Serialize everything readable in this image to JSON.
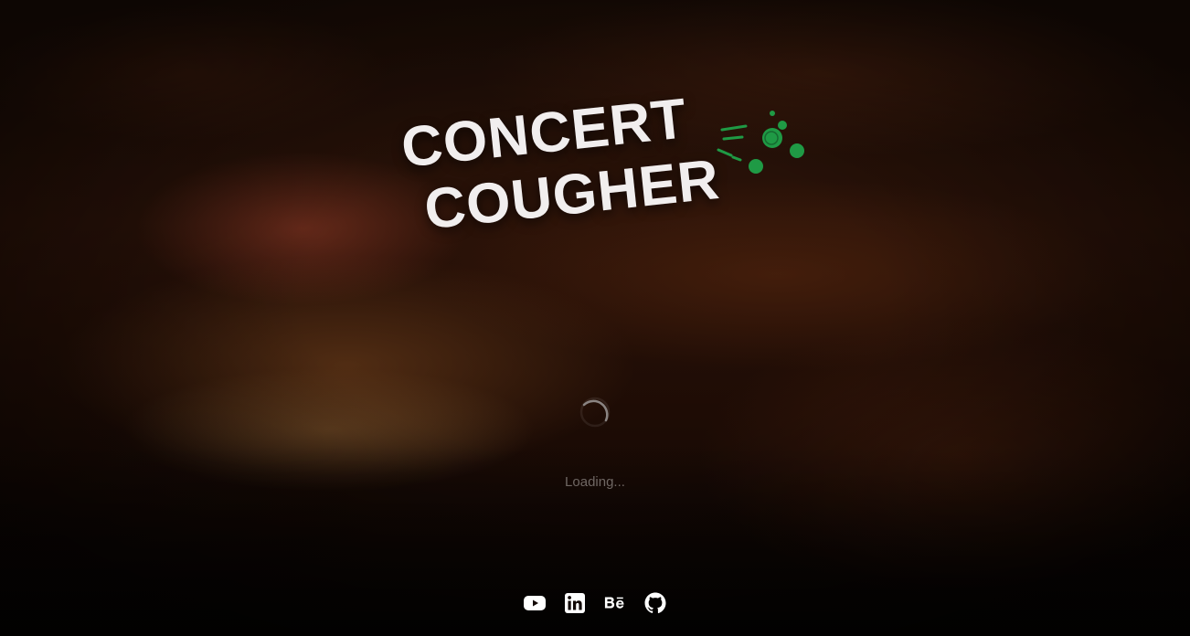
{
  "logo": {
    "line1": "CONCERT",
    "line2": "COUGHER",
    "text_color": "#f1eeee",
    "accent_color": "#1f9a45"
  },
  "loader": {
    "text": "Loading..."
  },
  "socials": [
    {
      "name": "youtube",
      "icon": "youtube-icon"
    },
    {
      "name": "linkedin",
      "icon": "linkedin-icon"
    },
    {
      "name": "behance",
      "icon": "behance-icon"
    },
    {
      "name": "github",
      "icon": "github-icon"
    }
  ]
}
